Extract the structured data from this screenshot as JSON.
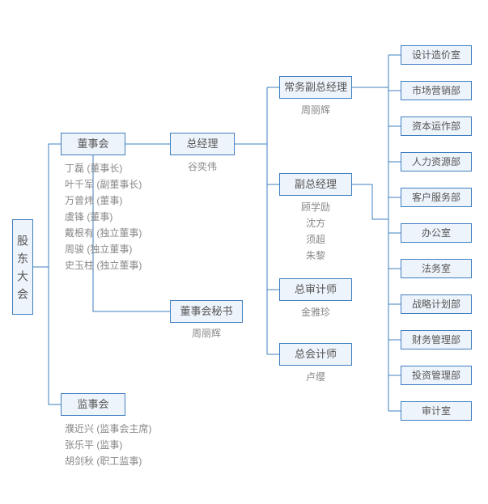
{
  "root": "股东大会",
  "board": {
    "title": "董事会",
    "members": [
      "丁磊 (董事长)",
      "叶千军 (副董事长)",
      "万曾炜 (董事)",
      "虞锋 (董事)",
      "戴根有 (独立董事)",
      "周骏 (独立董事)",
      "史玉柱 (独立董事)"
    ]
  },
  "supervisory": {
    "title": "监事会",
    "members": [
      "濮近兴 (监事会主席)",
      "张乐平 (监事)",
      "胡剑秋 (职工监事)"
    ]
  },
  "board_secretary": {
    "title": "董事会秘书",
    "person": "周丽辉"
  },
  "gm": {
    "title": "总经理",
    "person": "谷奕伟"
  },
  "exec_deputy_gm": {
    "title": "常务副总经理",
    "person": "周丽辉"
  },
  "deputy_gm": {
    "title": "副总经理",
    "people": [
      "顾学励",
      "沈方",
      "须超",
      "朱黎"
    ]
  },
  "chief_auditor": {
    "title": "总审计师",
    "person": "金雅珍"
  },
  "chief_accountant": {
    "title": "总会计师",
    "person": "卢缨"
  },
  "departments": [
    "设计造价室",
    "市场营销部",
    "资本运作部",
    "人力资源部",
    "客户服务部",
    "办公室",
    "法务室",
    "战略计划部",
    "财务管理部",
    "投资管理部",
    "审计室"
  ]
}
